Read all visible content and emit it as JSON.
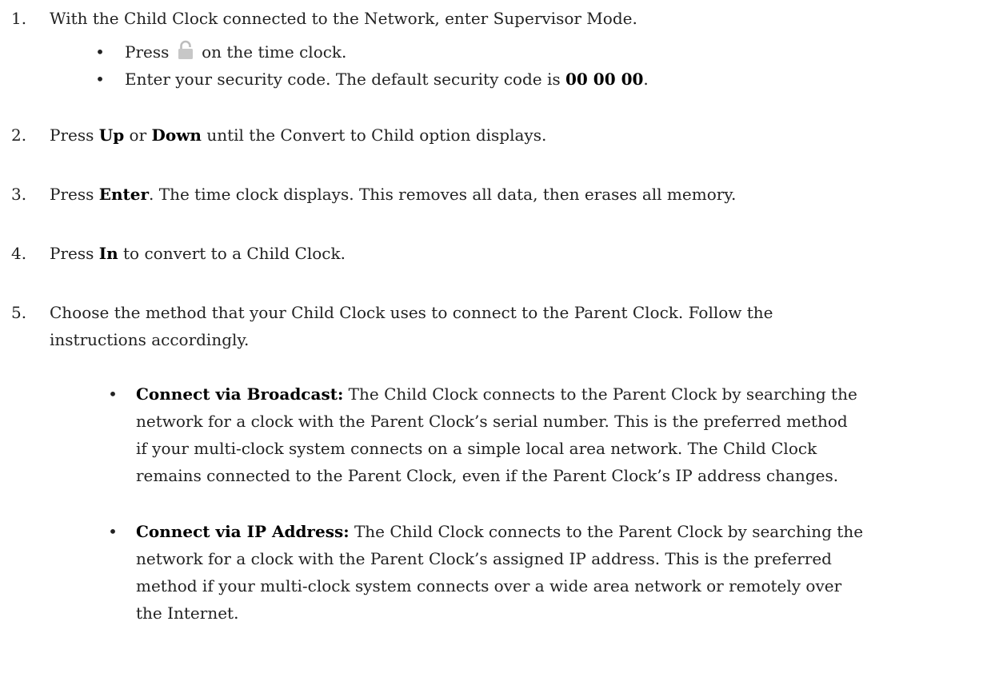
{
  "steps": [
    {
      "num": "1.",
      "text": "With the Child Clock connected to the Network, enter Supervisor Mode."
    },
    {
      "num": "2.",
      "pre": "Press ",
      "b1": "Up",
      "mid": " or ",
      "b2": "Down",
      "post": " until the Convert to Child option displays."
    },
    {
      "num": "3.",
      "pre": "Press ",
      "b1": "Enter",
      "post": ". The time clock displays. This removes all data, then erases all memory."
    },
    {
      "num": "4.",
      "pre": "Press ",
      "b1": "In",
      "post": " to convert to a Child Clock."
    },
    {
      "num": "5.",
      "line1": "Choose the method that your Child Clock uses to connect to the Parent Clock. Follow the",
      "line2": "instructions accordingly."
    }
  ],
  "substeps": [
    {
      "pre": "Press",
      "icon": "lock-icon",
      "post": "on the time clock."
    },
    {
      "pre": "Enter your security code. The default security code is ",
      "code": "00 00 00",
      "post": "."
    }
  ],
  "methods": [
    {
      "title": "Connect via Broadcast:",
      "lines": [
        " The Child Clock connects to the Parent Clock by searching the",
        "network for a clock with the Parent Clock’s serial number. This is the preferred method",
        "if your multi-clock system connects on a simple local area network. The Child Clock",
        "remains connected to the Parent Clock, even if the Parent Clock’s IP address changes."
      ]
    },
    {
      "title": "Connect via IP Address:",
      "lines": [
        " The Child Clock connects to the Parent Clock by searching the",
        "network for a clock with the Parent Clock’s assigned IP address. This is the preferred",
        "method if your multi-clock system connects over a wide area network or remotely over",
        "the Internet."
      ]
    }
  ],
  "bullet": "•"
}
